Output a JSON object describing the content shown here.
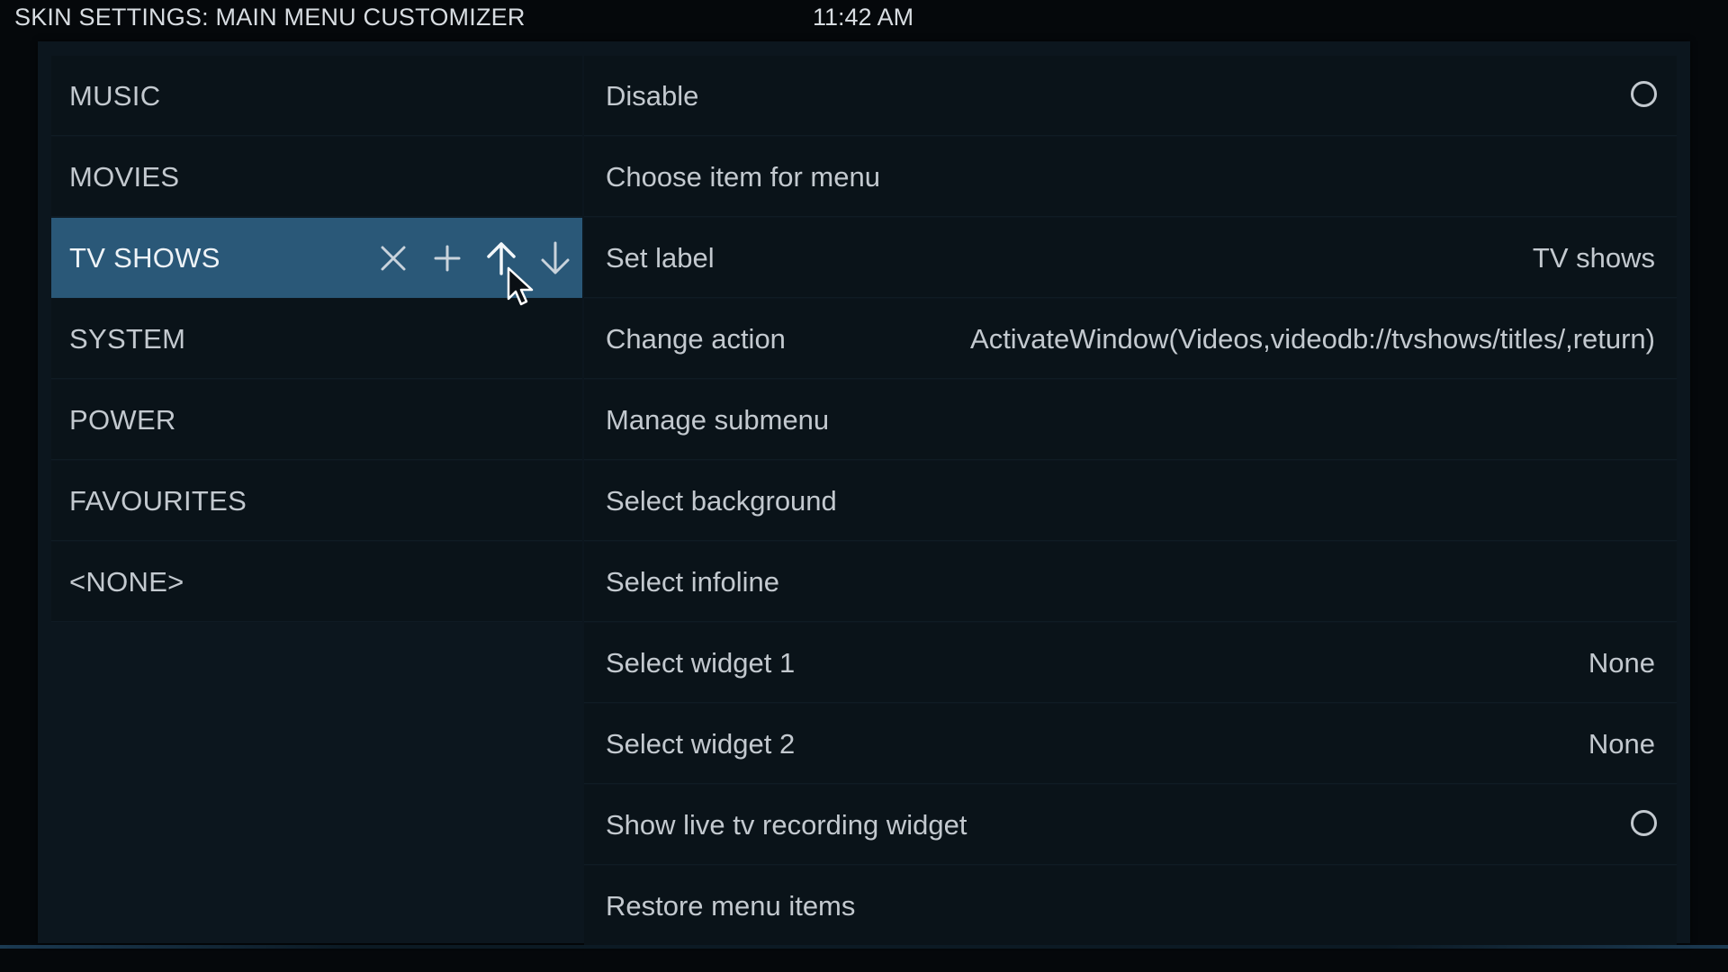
{
  "header": {
    "title": "SKIN SETTINGS: MAIN MENU CUSTOMIZER",
    "clock": "11:42 AM"
  },
  "menu_items": [
    {
      "label": "MUSIC"
    },
    {
      "label": "MOVIES"
    },
    {
      "label": "TV SHOWS",
      "selected": true
    },
    {
      "label": "SYSTEM"
    },
    {
      "label": "POWER"
    },
    {
      "label": "FAVOURITES"
    },
    {
      "label": "<NONE>"
    }
  ],
  "selected_item_actions": [
    "delete-icon",
    "add-icon",
    "move-up-icon",
    "move-down-icon"
  ],
  "options": [
    {
      "label": "Disable",
      "value": "",
      "control": "radio",
      "checked": false
    },
    {
      "label": "Choose item for menu",
      "value": ""
    },
    {
      "label": "Set label",
      "value": "TV shows"
    },
    {
      "label": "Change action",
      "value": "ActivateWindow(Videos,videodb://tvshows/titles/,return)"
    },
    {
      "label": "Manage submenu",
      "value": ""
    },
    {
      "label": "Select background",
      "value": ""
    },
    {
      "label": "Select infoline",
      "value": ""
    },
    {
      "label": "Select widget 1",
      "value": "None"
    },
    {
      "label": "Select widget 2",
      "value": "None"
    },
    {
      "label": "Show live tv recording widget",
      "value": "",
      "control": "radio",
      "checked": false
    },
    {
      "label": "Restore menu items",
      "value": ""
    }
  ],
  "colors": {
    "selected_row": "#2a5878",
    "panel": "#0c161e",
    "text": "#c3c9cf"
  }
}
